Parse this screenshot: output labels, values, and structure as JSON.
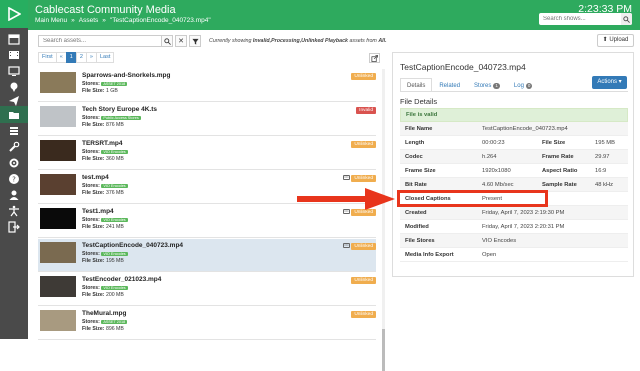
{
  "app": {
    "title": "Cablecast Community Media",
    "clock": "2:23:33 PM"
  },
  "breadcrumb": [
    "Main Menu",
    "»",
    "Assets",
    "»",
    "\"TestCaptionEncode_040723.mp4\""
  ],
  "top_search": {
    "placeholder": "Search shows..."
  },
  "upload_label": "Upload",
  "asset_search": {
    "placeholder": "Search assets..."
  },
  "showing": {
    "prefix": "Currently showing",
    "filters": "Invalid,Processing,Unlinked Playback",
    "middle": "assets from",
    "scope": "All."
  },
  "pager": [
    "First",
    "«",
    "1",
    "2",
    "»",
    "Last"
  ],
  "labels": {
    "stores": "Stores:",
    "file_size": "File Size:"
  },
  "assets": [
    {
      "name": "Sparrows-and-Snorkels.mpg",
      "store": "ASSET 2018",
      "size": "1 GB",
      "status": "Unlinked",
      "thumb": "#8a7a5a"
    },
    {
      "name": "Tech Story Europe 4K.ts",
      "store": "Public Access Stores",
      "size": "876 MB",
      "status": "Invalid",
      "thumb": "#bfc3c7"
    },
    {
      "name": "TERSRT.mp4",
      "store": "VIO Encodes",
      "size": "360 MB",
      "status": "Unlinked",
      "thumb": "#3a2a1e"
    },
    {
      "name": "test.mp4",
      "store": "VIO Encodes",
      "size": "376 MB",
      "status": "Unlinked",
      "thumb": "#5a4030",
      "cc": true
    },
    {
      "name": "Test1.mp4",
      "store": "VIO Encodes",
      "size": "241 MB",
      "status": "Unlinked",
      "thumb": "#0a0a0a",
      "cc": true
    },
    {
      "name": "TestCaptionEncode_040723.mp4",
      "store": "VIO Encodes",
      "size": "195 MB",
      "status": "Unlinked",
      "thumb": "#7a6a50",
      "cc": true,
      "selected": true
    },
    {
      "name": "TestEncoder_021023.mp4",
      "store": "VIO Encodes",
      "size": "200 MB",
      "status": "Unlinked",
      "thumb": "#3e3a36"
    },
    {
      "name": "TheMural.mpg",
      "store": "ASSET 2018",
      "size": "896 MB",
      "status": "Unlinked",
      "thumb": "#a89a80"
    }
  ],
  "detail": {
    "title": "TestCaptionEncode_040723.mp4",
    "tabs": [
      {
        "label": "Details"
      },
      {
        "label": "Related"
      },
      {
        "label": "Stores",
        "count": "1"
      },
      {
        "label": "Log",
        "count": "0"
      }
    ],
    "actions_label": "Actions ▾",
    "section": "File Details",
    "valid": "File is valid",
    "rows": [
      {
        "k": "File Name",
        "v": "TestCaptionEncode_040723.mp4"
      },
      {
        "k": "Length",
        "v": "00:00:23",
        "k2": "File Size",
        "v2": "195 MB"
      },
      {
        "k": "Codec",
        "v": "h.264",
        "k2": "Frame Rate",
        "v2": "29.97"
      },
      {
        "k": "Frame Size",
        "v": "1920x1080",
        "k2": "Aspect Ratio",
        "v2": "16:9"
      },
      {
        "k": "Bit Rate",
        "v": "4.60 Mb/sec",
        "k2": "Sample Rate",
        "v2": "48 kHz"
      },
      {
        "k": "Closed Captions",
        "v": "Present"
      },
      {
        "k": "Created",
        "v": "Friday, April 7, 2023 2:19:30 PM"
      },
      {
        "k": "Modified",
        "v": "Friday, April 7, 2023 2:20:31 PM"
      },
      {
        "k": "File Stores",
        "v": "VIO Encodes",
        "link": true
      },
      {
        "k": "Media Info Export",
        "v": "Open",
        "link": true
      }
    ]
  },
  "colors": {
    "brand": "#2eaa5e",
    "sidebar": "#4a4a4a",
    "primary": "#337ab7",
    "highlight": "#e8351c",
    "unlinked": "#f0ad4e",
    "invalid": "#d9534f"
  }
}
